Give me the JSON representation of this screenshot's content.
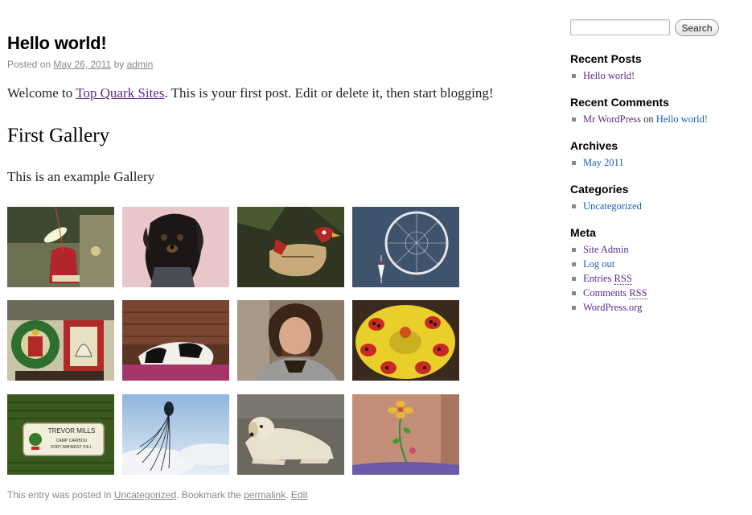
{
  "post": {
    "title": "Hello world!",
    "meta_prefix": "Posted on",
    "date": "May 26, 2011",
    "meta_by": "by",
    "author": "admin",
    "intro_before": "Welcome to",
    "intro_link": "Top Quark Sites",
    "intro_after": ". This is your first post. Edit or delete it, then start blogging!",
    "gallery_heading": "First Gallery",
    "gallery_desc": "This is an example Gallery",
    "footer_prefix": "This entry was posted in",
    "footer_category": "Uncategorized",
    "footer_middle": ". Bookmark the",
    "footer_permalink": "permalink",
    "footer_sep": ".",
    "footer_edit": "Edit"
  },
  "gallery": [
    {
      "name": "ornament-lights",
      "bg": "#6d7052"
    },
    {
      "name": "black-dog-portrait",
      "bg": "#e8c6c9"
    },
    {
      "name": "bird-ornament",
      "bg": "#2f3520"
    },
    {
      "name": "dreamcatcher",
      "bg": "#3b4f6b"
    },
    {
      "name": "stained-glass-bells",
      "bg": "#c9c3a8"
    },
    {
      "name": "sleeping-dog",
      "bg": "#5a3323"
    },
    {
      "name": "curly-hair-man",
      "bg": "#8a7a68"
    },
    {
      "name": "ladybug-toy",
      "bg": "#3a2a1e"
    },
    {
      "name": "name-badge",
      "bg": "#3c5a1e"
    },
    {
      "name": "peacock-feather",
      "bg": "#a8c6e3"
    },
    {
      "name": "golden-retriever",
      "bg": "#6b6860"
    },
    {
      "name": "back-tattoo",
      "bg": "#c48f78"
    }
  ],
  "badge_text": {
    "line1": "TREVOR MILLS",
    "line2": "CAMP CARIBOU",
    "line3": "FORT AMHERST P.E.I."
  },
  "sidebar": {
    "search_button": "Search",
    "search_value": "",
    "recent_posts": {
      "title": "Recent Posts",
      "items": [
        "Hello world!"
      ]
    },
    "recent_comments": {
      "title": "Recent Comments",
      "author": "Mr WordPress",
      "on": "on",
      "post": "Hello world!"
    },
    "archives": {
      "title": "Archives",
      "items": [
        "May 2011"
      ]
    },
    "categories": {
      "title": "Categories",
      "items": [
        "Uncategorized"
      ]
    },
    "meta": {
      "title": "Meta",
      "site_admin": "Site Admin",
      "log_out": "Log out",
      "entries": "Entries",
      "comments": "Comments",
      "rss": "RSS",
      "wordpress": "WordPress.org"
    }
  },
  "colors": {
    "link_visited": "#5e2a87",
    "link": "#1a5fb4",
    "meta_gray": "#888888",
    "title": "#000000"
  }
}
